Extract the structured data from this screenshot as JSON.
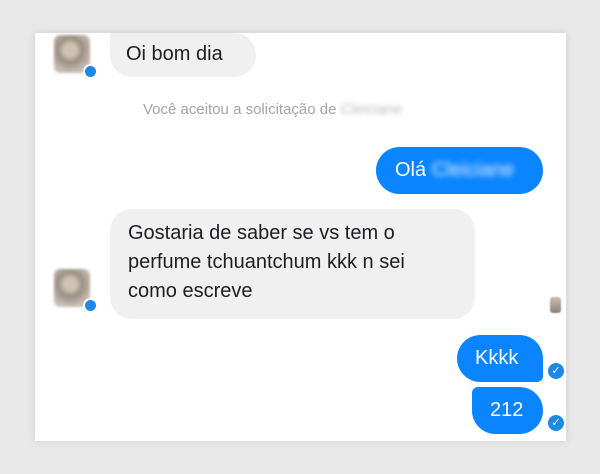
{
  "conversation": {
    "messages": [
      {
        "direction": "incoming",
        "text": "Oi bom dia"
      },
      {
        "direction": "outgoing",
        "text": "Olá",
        "blurred_name": "Cleiciane"
      },
      {
        "direction": "incoming",
        "lines": [
          "Gostaria de saber se vs tem o",
          "perfume tchuantchum kkk n sei",
          "como escreve"
        ]
      },
      {
        "direction": "outgoing",
        "text": "Kkkk"
      },
      {
        "direction": "outgoing",
        "text": "212"
      }
    ],
    "notice": {
      "prefix": "Você aceitou a solicitação de",
      "blurred_name": "Cleiciane"
    }
  },
  "colors": {
    "outgoing_bubble": "#0b84ff",
    "incoming_bubble": "#f1f0f0",
    "read_check": "#1e88e5",
    "notice_text": "#a1a4a8"
  },
  "icons": {
    "avatar": "contact-avatar-blurred",
    "read_receipt": "blue-check-circle-icon",
    "seen_marker": "seen-avatar-icon"
  }
}
